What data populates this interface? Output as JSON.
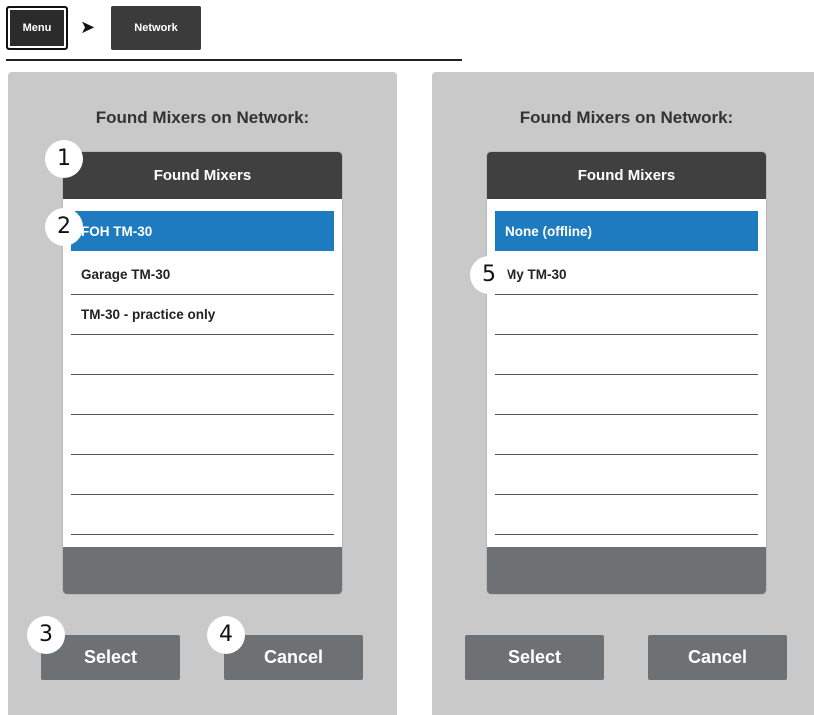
{
  "breadcrumb": {
    "menu": "Menu",
    "separator": "➤",
    "network": "Network"
  },
  "left_panel": {
    "title": "Found Mixers on Network:",
    "list_header": "Found Mixers",
    "items": [
      {
        "label": "FOH TM-30",
        "selected": true
      },
      {
        "label": "Garage TM-30",
        "selected": false
      },
      {
        "label": "TM-30 - practice only",
        "selected": false
      },
      {
        "label": "",
        "selected": false
      },
      {
        "label": "",
        "selected": false
      },
      {
        "label": "",
        "selected": false
      },
      {
        "label": "",
        "selected": false
      },
      {
        "label": "",
        "selected": false
      }
    ],
    "select_label": "Select",
    "cancel_label": "Cancel"
  },
  "right_panel": {
    "title": "Found Mixers on Network:",
    "list_header": "Found Mixers",
    "items": [
      {
        "label": "None (offline)",
        "selected": true
      },
      {
        "label": "My TM-30",
        "selected": false
      },
      {
        "label": "",
        "selected": false
      },
      {
        "label": "",
        "selected": false
      },
      {
        "label": "",
        "selected": false
      },
      {
        "label": "",
        "selected": false
      },
      {
        "label": "",
        "selected": false
      },
      {
        "label": "",
        "selected": false
      }
    ],
    "select_label": "Select",
    "cancel_label": "Cancel"
  },
  "callouts": [
    "1",
    "2",
    "3",
    "4",
    "5"
  ],
  "colors": {
    "selected_row": "#1f7bbf",
    "panel_bg": "#c9c9c9",
    "header_bg": "#404040",
    "button_bg": "#6e7173"
  }
}
